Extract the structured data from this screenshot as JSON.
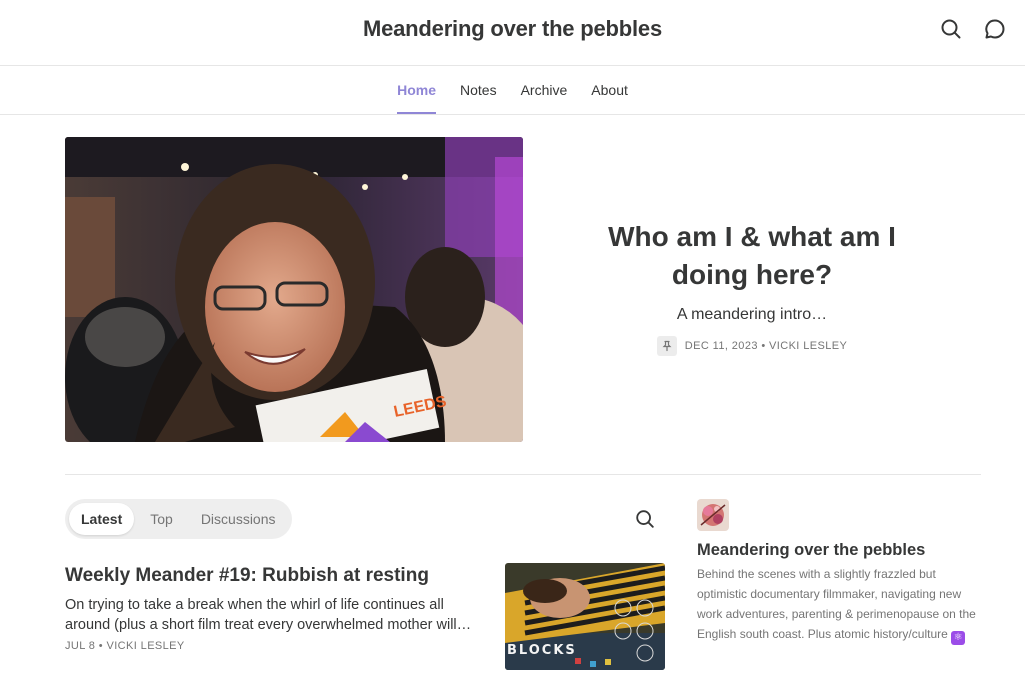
{
  "header": {
    "site_title": "Meandering over the pebbles",
    "icons": [
      "search-icon",
      "chat-icon"
    ]
  },
  "nav": {
    "items": [
      {
        "label": "Home",
        "active": true
      },
      {
        "label": "Notes",
        "active": false
      },
      {
        "label": "Archive",
        "active": false
      },
      {
        "label": "About",
        "active": false
      }
    ]
  },
  "hero": {
    "title": "Who am I & what am I doing here?",
    "subtitle": "A meandering intro…",
    "meta": "DEC 11, 2023 • VICKI LESLEY",
    "pinned": true,
    "image_sign_text": "LEEDS"
  },
  "tabs": {
    "items": [
      {
        "label": "Latest",
        "active": true
      },
      {
        "label": "Top",
        "active": false
      },
      {
        "label": "Discussions",
        "active": false
      }
    ]
  },
  "post": {
    "title": "Weekly Meander #19: Rubbish at resting",
    "description": "On trying to take a break when the whirl of life continues all around (plus a short film treat every overwhelmed mother will enjoy)",
    "meta": "JUL 8 • VICKI LESLEY",
    "thumb_caption": "BLOCKS"
  },
  "sidebar": {
    "title": "Meandering over the pebbles",
    "description": "Behind the scenes with a slightly frazzled but optimistic documentary filmmaker, navigating new work adventures, parenting & perimenopause on the English south coast. Plus atomic history/culture",
    "emoji": "⚛"
  },
  "colors": {
    "accent": "#8f86d6",
    "text": "#363737",
    "muted": "#757575",
    "border": "#e6e6e6"
  }
}
